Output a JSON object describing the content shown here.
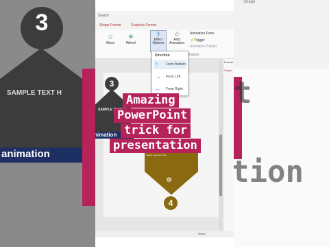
{
  "search": {
    "label": "Search"
  },
  "tabs": [
    "Shape Format",
    "Graphics Format"
  ],
  "ribbon": {
    "effect_wave": "Wave",
    "effect_wheel": "Wheel",
    "effect_options": "Effect\nOptions",
    "add_animation": "Add\nAnimation",
    "animation_pane": "Animation Pane",
    "trigger": "Trigger",
    "animation_painter": "Animation Painter",
    "advanced_animation": "Advanced Animation"
  },
  "dropdown": {
    "header": "Direction",
    "items": [
      "From Bottom",
      "From Left",
      "From Right"
    ]
  },
  "slide": {
    "badge_top": "3",
    "badge_bottom": "4",
    "sample_text": "SAMPLE TEXT H",
    "body_text": "Lorem ipsum dolor sit amet. Maecenas porttitor congue massa. Fusce posuere, magna sed pulvinar ultricies, purus lectus malesuada libero, sit amet commodo magna eros quis urna.",
    "animation_label": "nimation"
  },
  "caption": {
    "lines": [
      "Amazing",
      "PowerPoint",
      "trick for",
      "presentation"
    ]
  },
  "side": {
    "pane_title": "Format",
    "pane_tab": "Shape",
    "right_label": "Shape"
  },
  "bg": {
    "big_number": "3",
    "sample_text": "SAMPLE TEXT H",
    "animation": "animation",
    "right_text_1": "t",
    "right_text_2": "tion"
  },
  "status": {
    "notes": "Notes"
  },
  "colors": {
    "accent": "#b5235a",
    "dark": "#3c3c3c",
    "gold": "#8a6a10",
    "navy": "#1e2f63"
  }
}
